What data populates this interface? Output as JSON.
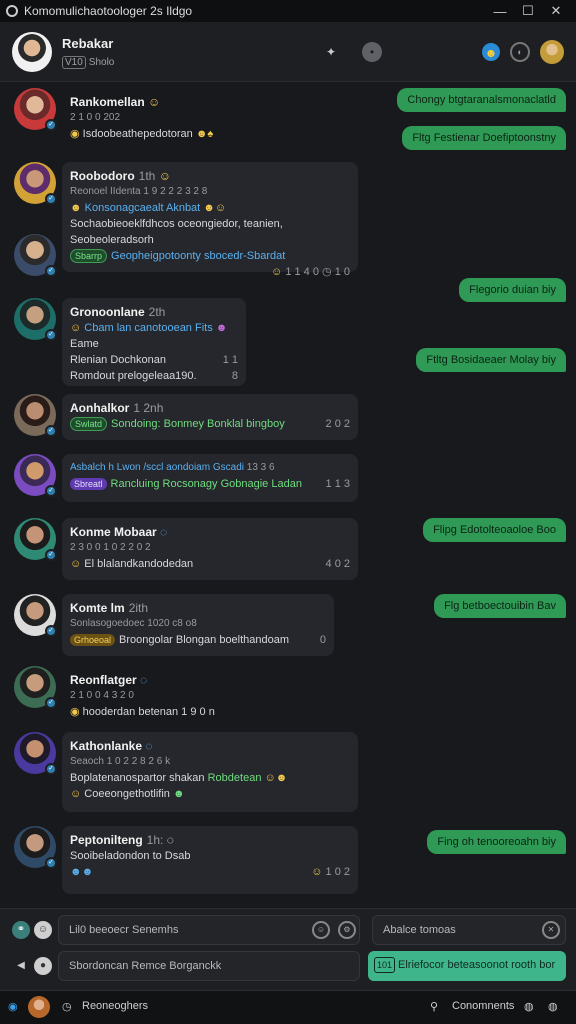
{
  "window": {
    "title": "Komomulichaotoologer 2s Ildgo",
    "controls": [
      "—",
      "☐",
      "✕"
    ]
  },
  "header": {
    "name": "Rebakar",
    "tag": "V10",
    "sub": "Sholo"
  },
  "messages": [
    {
      "name": "Rankomellan",
      "line1": "2 1 0 0 202",
      "line2": "Isdoobeathepedotoran"
    },
    {
      "name": "Roobodoro",
      "time": "1th",
      "line1": "Reonoel IIdenta 1 9 2 2 2 3 2 8",
      "line2": "Konsonagcaealt Aknbat",
      "line3": "Sochaobieoeklfdhcos oceongiedor, teanien,",
      "line4": "Seobeoleradsorh",
      "pill": "Sbarrp",
      "line5": "Geopheigpotoonty sbocedr-Sbardat",
      "count": "1 1 4 0",
      "count2": "1 0"
    },
    {
      "name": "Gronoonlane",
      "time": "2th",
      "line1": "Cbam lan canotooean Fits",
      "line2": "Eame",
      "line3": "Rlenian Dochkonan",
      "count": "1 1",
      "line4": "Romdout prelogeleaa190.",
      "count2": "8"
    },
    {
      "name": "Aonhalkor",
      "time": "1 2nh",
      "pill": "Swlatd",
      "line1": "Sondoing: Bonmey Bonklal bingboy",
      "count": "2 0 2"
    },
    {
      "name": "Asbalch h Lwon /sccl aondoiam Gscadi",
      "time": "13 3 6",
      "pill": "Sbreatl",
      "line1": "Rancluing Rocsonagy Gobnagie Ladan",
      "count": "1 1 3"
    },
    {
      "name": "Konme Mobaar",
      "line1": "2 3 0 0 1 0 2 2 0 2",
      "line2": "El blalandkandodedan",
      "count": "4 0 2"
    },
    {
      "name": "Komte lm",
      "time": "2ith",
      "line1": "Sonlasogoedoec 1020 c8 o8",
      "pill": "Grhoeoal",
      "line2": "Broongolar Blongan boelthandoam",
      "count": "0"
    },
    {
      "name": "Reonflatger",
      "line1": "2 1 0 0 4 3 2 0",
      "line2": "hooderdan betenan",
      "count": "1 9 0 n"
    },
    {
      "name": "Kathonlanke",
      "line1": "Seaoch 1 0 2 2 8 2 6 k",
      "line2": "Boplatenanospartor shakan",
      "hl": "Robdetean",
      "line3": "Coeeongethotlifin"
    },
    {
      "name": "Peptonilteng",
      "time": "1h:",
      "line1": "Sooibeladondon to Dsab",
      "count": "1 0 2"
    }
  ],
  "bubbles": [
    "Chongy btgtaranalsmonaclatld",
    "Fltg Festienar Doefiptoonstny",
    "Flegorio duian biy",
    "Ftltg Bosidaeaer Molay biy",
    "Flipg Edotolteoaoloe Boo",
    "Flg betboectouibin Bav",
    "Fing oh tenooreoahn biy"
  ],
  "composer": {
    "field1": "Lil0 beeoecr Senemhs",
    "field2": "Sbordoncan Remce Borganckk",
    "search": "Abalce tomoas",
    "send_tag": "101",
    "send_label": "Elriefocor beteasoonot rooth bor"
  },
  "statusbar": {
    "left": "Reoneoghers",
    "right": "Conomnents"
  }
}
